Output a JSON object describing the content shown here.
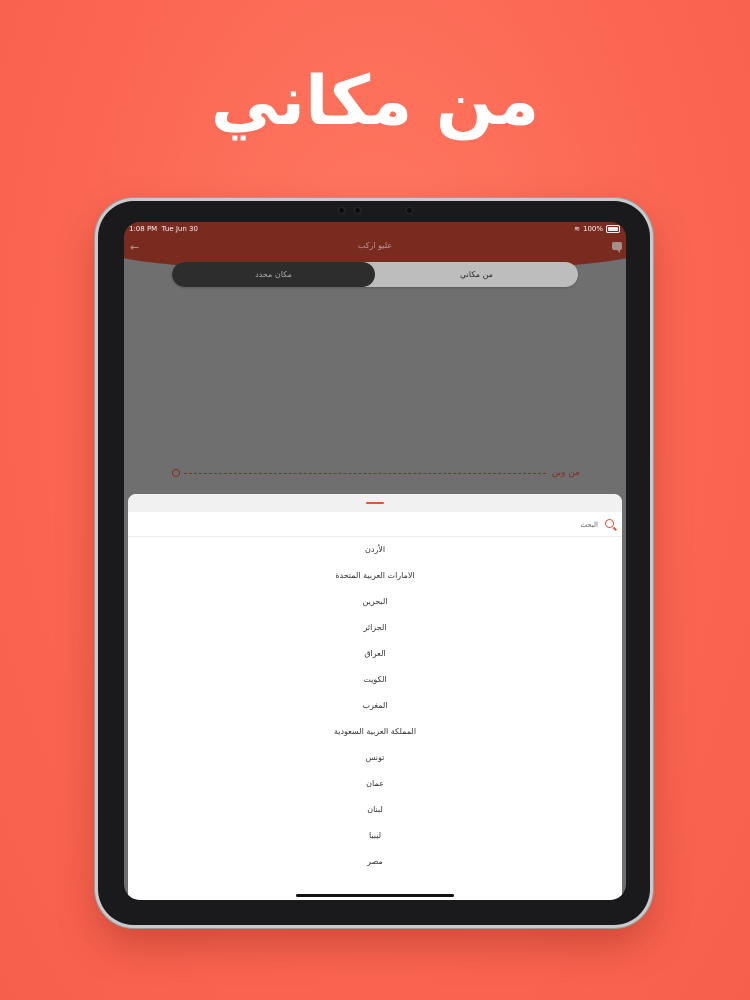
{
  "headline": "من مكاني",
  "status_bar": {
    "time": "1:08 PM",
    "date": "Tue Jun 30",
    "battery": "100%"
  },
  "app": {
    "title": "عليو اركب"
  },
  "segmented": {
    "left_label": "مكان محدد",
    "right_label": "من مكاني",
    "selected": "left"
  },
  "route": {
    "from_label": "من وين"
  },
  "sheet": {
    "search_placeholder": "البحث",
    "countries": [
      "الأردن",
      "الامارات العربية المتحدة",
      "البحرين",
      "الجزائر",
      "العراق",
      "الكويت",
      "المغرب",
      "المملكة العربية السعودية",
      "تونس",
      "عمان",
      "لبنان",
      "ليبيا",
      "مصر"
    ]
  },
  "colors": {
    "background": "#fb6753",
    "app_bar": "#7a2b20",
    "accent": "#e2533f",
    "overlay": "#6f6f6f"
  }
}
